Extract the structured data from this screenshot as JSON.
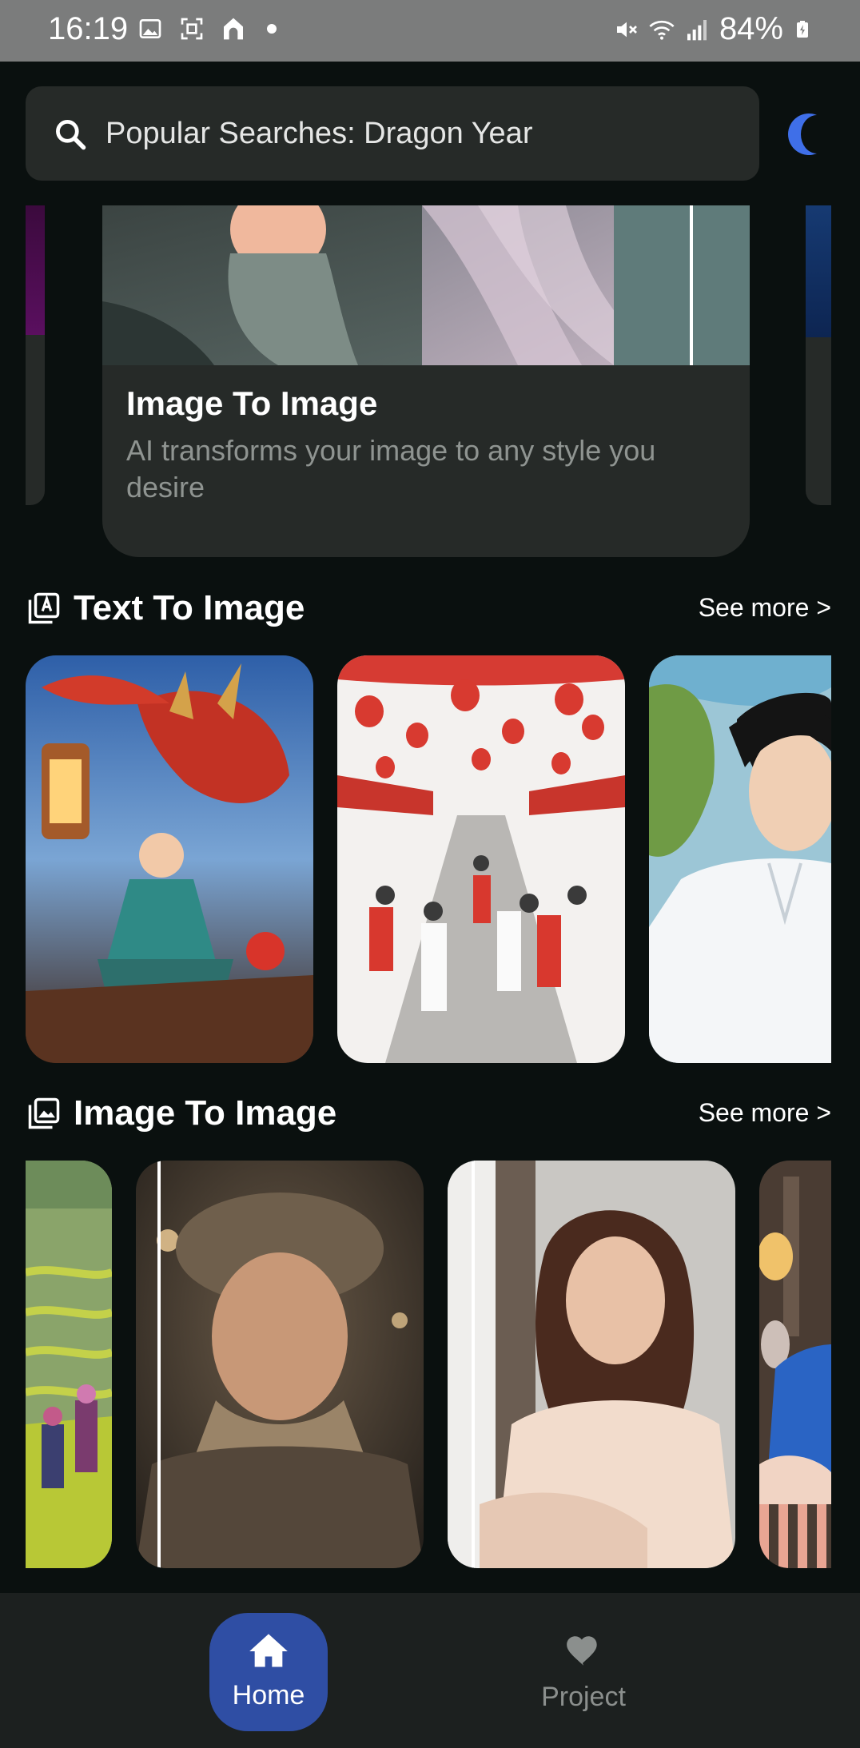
{
  "status_bar": {
    "time": "16:19",
    "left_icons": [
      "image-icon",
      "screenshot-icon",
      "home-app-icon",
      "notification-dot-icon"
    ],
    "right_icons": [
      "mute-icon",
      "wifi-icon",
      "signal-icon",
      "battery-charging-icon"
    ],
    "battery": "84%"
  },
  "search": {
    "placeholder": "Popular Searches: Dragon Year",
    "icon": "search-icon"
  },
  "theme_toggle": {
    "icon": "moon-icon",
    "color": "#3f6fe8"
  },
  "featured": {
    "title": "Image To Image",
    "description": "AI transforms your image to any style you desire"
  },
  "sections": [
    {
      "title": "Text To Image",
      "icon": "text-image-icon",
      "see_more": "See more >",
      "tiles": [
        "dragon-illustration",
        "lantern-market-illustration",
        "anime-boy-illustration"
      ]
    },
    {
      "title": "Image To Image",
      "icon": "gallery-icon",
      "see_more": "See more >",
      "tiles": [
        "rice-terrace-photo",
        "boy-beret-photo",
        "woman-portrait-photo",
        "blue-shirt-photo"
      ]
    }
  ],
  "bottom_nav": {
    "items": [
      {
        "label": "Home",
        "icon": "home-icon",
        "active": true
      },
      {
        "label": "Project",
        "icon": "heart-icon",
        "active": false
      }
    ],
    "active_color": "#2f4ea4"
  }
}
